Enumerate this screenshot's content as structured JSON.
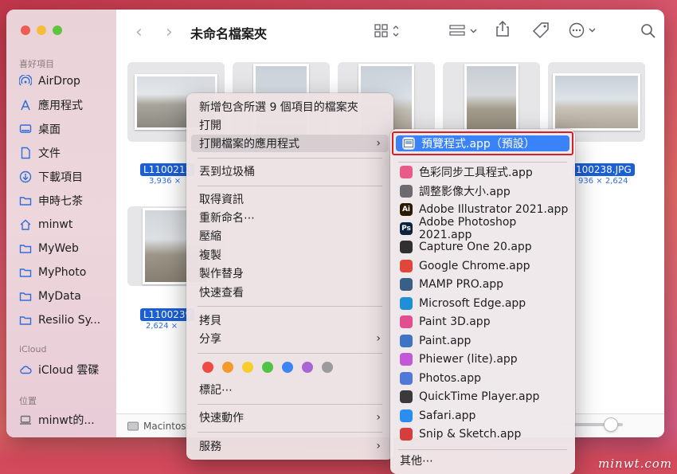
{
  "window": {
    "title": "未命名檔案夾"
  },
  "sidebar": {
    "favorites_header": "喜好項目",
    "favorites": [
      {
        "label": "AirDrop",
        "icon": "airdrop-icon"
      },
      {
        "label": "應用程式",
        "icon": "applications-icon"
      },
      {
        "label": "桌面",
        "icon": "desktop-icon"
      },
      {
        "label": "文件",
        "icon": "document-icon"
      },
      {
        "label": "下載項目",
        "icon": "download-icon"
      },
      {
        "label": "申時七茶",
        "icon": "folder-icon"
      },
      {
        "label": "minwt",
        "icon": "home-icon"
      },
      {
        "label": "MyWeb",
        "icon": "folder-icon"
      },
      {
        "label": "MyPhoto",
        "icon": "folder-icon"
      },
      {
        "label": "MyData",
        "icon": "folder-icon"
      },
      {
        "label": "Resilio Sy...",
        "icon": "folder-icon"
      }
    ],
    "icloud_header": "iCloud",
    "icloud_items": [
      {
        "label": "iCloud 雲碟",
        "icon": "cloud-icon"
      }
    ],
    "locations_header": "位置",
    "locations": [
      {
        "label": "minwt的...",
        "icon": "laptop-icon"
      }
    ]
  },
  "files": [
    {
      "name": "L1100213",
      "size": "3,936 ×"
    },
    {
      "name": "100238.JPG",
      "size": "936 × 2,624"
    },
    {
      "name": "L1100239",
      "size": "2,624 ×"
    }
  ],
  "pathbar": {
    "label": "Macintosh"
  },
  "context_menu": {
    "new_folder_with_selection": "新增包含所選 9 個項目的檔案夾",
    "open": "打開",
    "open_with": "打開檔案的應用程式",
    "move_to_trash": "丟到垃圾桶",
    "get_info": "取得資訊",
    "rename": "重新命名⋯",
    "compress": "壓縮",
    "duplicate": "複製",
    "make_alias": "製作替身",
    "quick_look": "快速查看",
    "copy": "拷貝",
    "share": "分享",
    "tags": "標記⋯",
    "quick_actions": "快速動作",
    "services": "服務",
    "tag_colors": [
      "#ee4b45",
      "#f39a2c",
      "#f6cc2f",
      "#4fc442",
      "#3b86f2",
      "#a766d3",
      "#9b9b9d"
    ]
  },
  "open_with_menu": {
    "default_app": "預覽程式.app（預設）",
    "apps": [
      {
        "label": "色彩同步工具程式.app",
        "color": "#e85c8a"
      },
      {
        "label": "調整影像大小.app",
        "color": "#6b6b70"
      },
      {
        "label": "Adobe Illustrator 2021.app",
        "color": "#2c1a00",
        "glyph": "Ai"
      },
      {
        "label": "Adobe Photoshop 2021.app",
        "color": "#0c2340",
        "glyph": "Ps"
      },
      {
        "label": "Capture One 20.app",
        "color": "#303030"
      },
      {
        "label": "Google Chrome.app",
        "color": "#e1463b"
      },
      {
        "label": "MAMP PRO.app",
        "color": "#3a5f87"
      },
      {
        "label": "Microsoft Edge.app",
        "color": "#1f8fd6"
      },
      {
        "label": "Paint 3D.app",
        "color": "#e24e8e"
      },
      {
        "label": "Paint.app",
        "color": "#3f74c4"
      },
      {
        "label": "Phiewer (lite).app",
        "color": "#c258d6"
      },
      {
        "label": "Photos.app",
        "color": "#4f78d8"
      },
      {
        "label": "QuickTime Player.app",
        "color": "#3a3a3c"
      },
      {
        "label": "Safari.app",
        "color": "#2a8ef0"
      },
      {
        "label": "Snip & Sketch.app",
        "color": "#d63d3d"
      }
    ],
    "other": "其他⋯"
  },
  "watermark": "minwt.com"
}
